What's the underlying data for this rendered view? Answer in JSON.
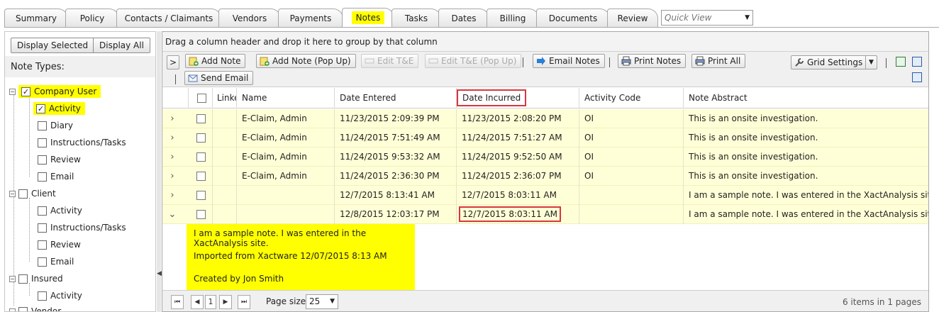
{
  "tabs": [
    {
      "label": "Summary"
    },
    {
      "label": "Policy"
    },
    {
      "label": "Contacts / Claimants"
    },
    {
      "label": "Vendors"
    },
    {
      "label": "Payments"
    },
    {
      "label": "Notes"
    },
    {
      "label": "Tasks"
    },
    {
      "label": "Dates"
    },
    {
      "label": "Billing"
    },
    {
      "label": "Documents"
    },
    {
      "label": "Review"
    }
  ],
  "quick_view": {
    "placeholder": "Quick View"
  },
  "left_panel": {
    "display_selected": "Display Selected",
    "display_all": "Display All",
    "note_types_label": "Note Types:",
    "tree": [
      {
        "label": "Company User",
        "checked": true
      },
      {
        "label": "Activity",
        "checked": true
      },
      {
        "label": "Diary",
        "checked": false
      },
      {
        "label": "Instructions/Tasks",
        "checked": false
      },
      {
        "label": "Review",
        "checked": false
      },
      {
        "label": "Email",
        "checked": false
      },
      {
        "label": "Client",
        "checked": false
      },
      {
        "label": "Activity",
        "checked": false
      },
      {
        "label": "Instructions/Tasks",
        "checked": false
      },
      {
        "label": "Review",
        "checked": false
      },
      {
        "label": "Email",
        "checked": false
      },
      {
        "label": "Insured",
        "checked": false
      },
      {
        "label": "Activity",
        "checked": false
      },
      {
        "label": "Vendor",
        "checked": false
      }
    ]
  },
  "grid": {
    "group_hint": "Drag a column header and drop it here to group by that column",
    "toolbar": {
      "expand": ">",
      "add_note": "Add Note",
      "add_note_popup": "Add Note (Pop Up)",
      "edit_te": "Edit T&E",
      "edit_te_popup": "Edit T&E (Pop Up)",
      "email_notes": "Email Notes",
      "print_notes": "Print Notes",
      "print_all": "Print All",
      "grid_settings": "Grid Settings",
      "send_email": "Send Email"
    },
    "columns": {
      "linked": "Linke",
      "name": "Name",
      "date_entered": "Date Entered",
      "date_incurred": "Date Incurred",
      "activity_code": "Activity Code",
      "note_abstract": "Note Abstract"
    },
    "rows": [
      {
        "expander": "›",
        "name": "E-Claim, Admin",
        "date_entered": "11/23/2015 2:09:39 PM",
        "date_incurred": "11/23/2015 2:08:20 PM",
        "activity_code": "OI",
        "note_abstract": "This is an onsite investigation."
      },
      {
        "expander": "›",
        "name": "E-Claim, Admin",
        "date_entered": "11/24/2015 7:51:49 AM",
        "date_incurred": "11/24/2015 7:51:27 AM",
        "activity_code": "OI",
        "note_abstract": "This is an onsite investigation."
      },
      {
        "expander": "›",
        "name": "E-Claim, Admin",
        "date_entered": "11/24/2015 9:53:32 AM",
        "date_incurred": "11/24/2015 9:52:50 AM",
        "activity_code": "OI",
        "note_abstract": "This is an onsite investigation."
      },
      {
        "expander": "›",
        "name": "E-Claim, Admin",
        "date_entered": "11/24/2015 2:36:30 PM",
        "date_incurred": "11/24/2015 2:36:07 PM",
        "activity_code": "OI",
        "note_abstract": "This is an onsite investigation."
      },
      {
        "expander": "›",
        "name": "",
        "date_entered": "12/7/2015 8:13:41 AM",
        "date_incurred": "12/7/2015 8:03:11 AM",
        "activity_code": "",
        "note_abstract": "I am a sample note. I was entered in the XactAnalysis site. Impor"
      },
      {
        "expander": "⌄",
        "name": "",
        "date_entered": "12/8/2015 12:03:17 PM",
        "date_incurred": "12/7/2015 8:03:11 AM",
        "activity_code": "",
        "note_abstract": "I am a sample note. I was entered in the XactAnalysis site. Impor"
      }
    ],
    "detail": {
      "line1": "I am a sample note. I was entered in the XactAnalysis site.",
      "line2": "Imported from Xactware 12/07/2015 8:13 AM",
      "line3": "Created by Jon Smith"
    },
    "pager": {
      "current_page": "1",
      "page_size_label": "Page size:",
      "page_size": "25",
      "summary": "6 items in 1 pages"
    }
  },
  "colors": {
    "highlight": "#ffff00",
    "row_bg": "#ffffd7",
    "callout_red": "#d9363e"
  }
}
